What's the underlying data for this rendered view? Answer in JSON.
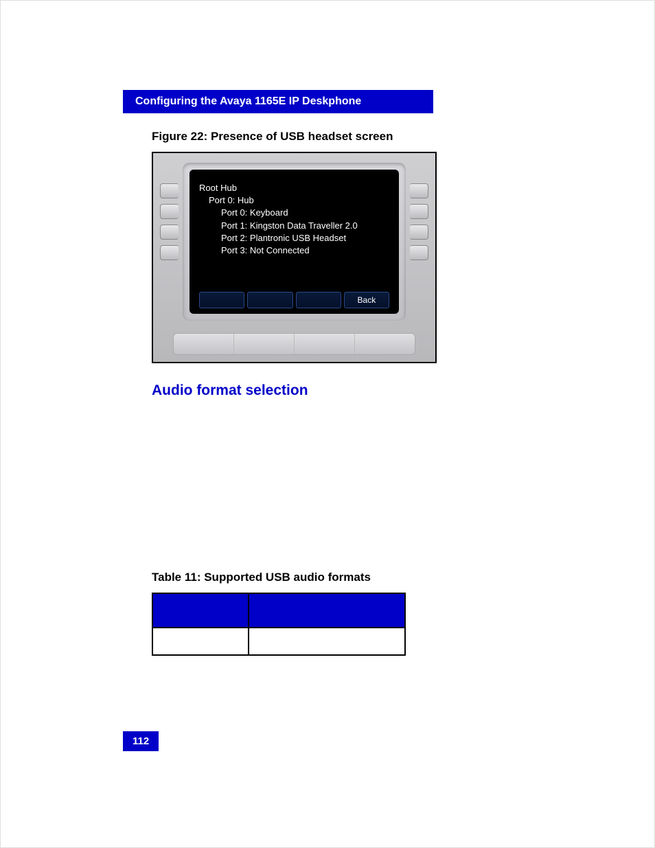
{
  "header": {
    "title": "Configuring the Avaya 1165E IP Deskphone"
  },
  "figure": {
    "caption": "Figure 22: Presence of USB headset screen",
    "tree": {
      "root": "Root Hub",
      "port0": "Port 0: Hub",
      "sub": [
        "Port 0: Keyboard",
        "Port 1: Kingston Data Traveller 2.0",
        "Port 2: Plantronic USB Headset",
        "Port 3: Not Connected"
      ]
    },
    "softkeys": [
      "",
      "",
      "",
      "Back"
    ]
  },
  "section": {
    "heading": "Audio format selection"
  },
  "table": {
    "caption": "Table 11: Supported USB audio formats"
  },
  "page_number": "112"
}
